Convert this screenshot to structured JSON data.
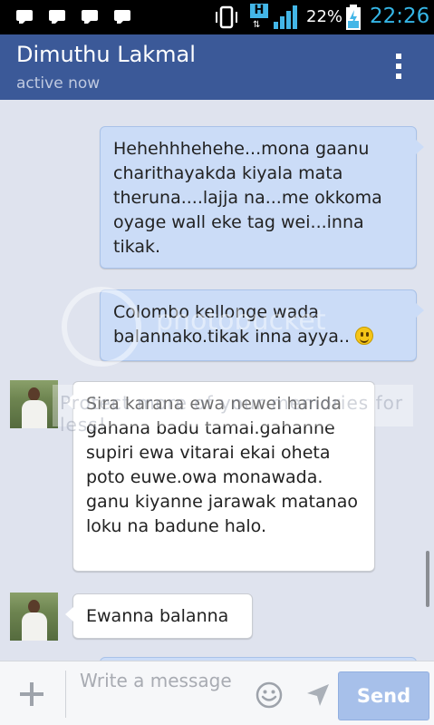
{
  "status_bar": {
    "battery_percent": "22%",
    "time": "22:26",
    "network_type": "H",
    "notification_count": 4
  },
  "header": {
    "contact_name": "Dimuthu Lakmal",
    "status": "active now"
  },
  "messages": [
    {
      "direction": "outgoing",
      "text": "Hehehhhehehe...mona gaanu charithayakda kiyala mata theruna....lajja na...me okkoma oyage wall eke tag wei...inna tikak."
    },
    {
      "direction": "outgoing",
      "text": "Colombo kellonge wada balannako.tikak inna ayya..",
      "emoji": "smiley"
    },
    {
      "direction": "incoming",
      "text": "Sira karana ewa newei harida gahana badu tamai.gahanne supiri ewa vitarai ekai oheta poto euwe.owa monawada. ganu kiyanne jarawak matanao loku na badune halo."
    },
    {
      "direction": "incoming",
      "text": "Ewanna balanna"
    }
  ],
  "composer": {
    "placeholder": "Write a message",
    "value": "",
    "send_label": "Send"
  },
  "colors": {
    "header_bg": "#3b5998",
    "chat_bg": "#dfe3ee",
    "outgoing_bubble": "#cbdcf7",
    "incoming_bubble": "#ffffff",
    "send_button": "#a7c0ea",
    "clock": "#35b5e5"
  }
}
